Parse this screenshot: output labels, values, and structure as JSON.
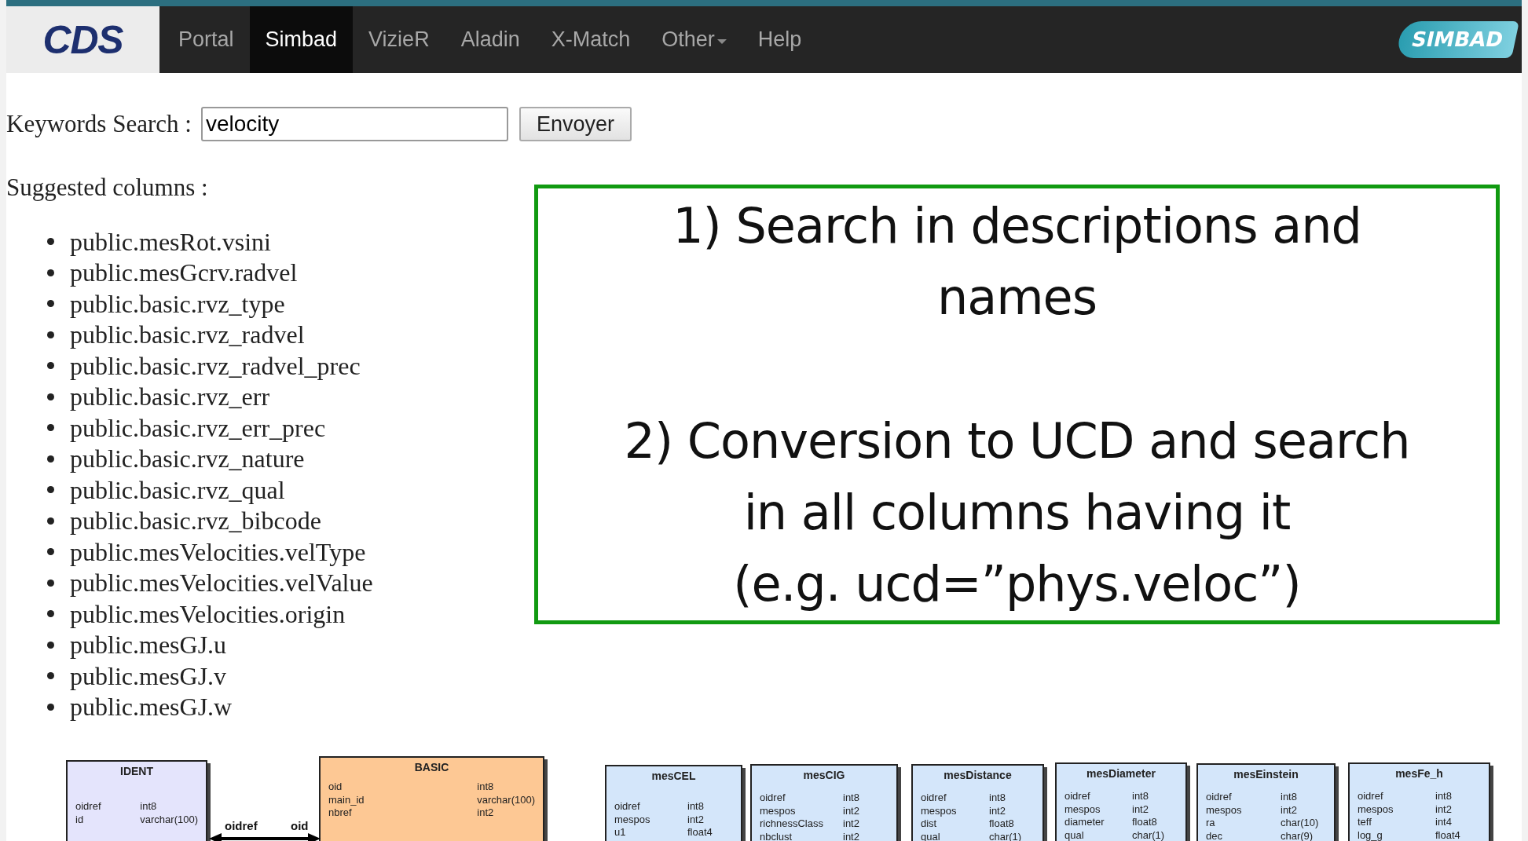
{
  "navbar": {
    "logo_text": "CDS",
    "items": [
      {
        "label": "Portal",
        "selected": false,
        "has_menu": false
      },
      {
        "label": "Simbad",
        "selected": true,
        "has_menu": false
      },
      {
        "label": "VizieR",
        "selected": false,
        "has_menu": false
      },
      {
        "label": "Aladin",
        "selected": false,
        "has_menu": false
      },
      {
        "label": "X-Match",
        "selected": false,
        "has_menu": false
      },
      {
        "label": "Other",
        "selected": false,
        "has_menu": true
      },
      {
        "label": "Help",
        "selected": false,
        "has_menu": false
      }
    ],
    "brand_text": "SIMBAD"
  },
  "search": {
    "label": "Keywords Search :",
    "value": "velocity",
    "button": "Envoyer"
  },
  "suggested": {
    "heading": "Suggested columns :",
    "items": [
      "public.mesRot.vsini",
      "public.mesGcrv.radvel",
      "public.basic.rvz_type",
      "public.basic.rvz_radvel",
      "public.basic.rvz_radvel_prec",
      "public.basic.rvz_err",
      "public.basic.rvz_err_prec",
      "public.basic.rvz_nature",
      "public.basic.rvz_qual",
      "public.basic.rvz_bibcode",
      "public.mesVelocities.velType",
      "public.mesVelocities.velValue",
      "public.mesVelocities.origin",
      "public.mesGJ.u",
      "public.mesGJ.v",
      "public.mesGJ.w"
    ]
  },
  "callout": {
    "paragraphs": [
      [
        "1) Search in descriptions and",
        "names"
      ],
      [
        "2) Conversion to UCD and search",
        "in all columns having it",
        "(e.g. ucd=”phys.veloc”)"
      ]
    ]
  },
  "diagram": {
    "relation": {
      "from_label": "oidref",
      "to_label": "oid"
    },
    "tables": [
      {
        "title": "IDENT",
        "color": "#e4e4fc",
        "columns": [
          {
            "name": "oidref",
            "type": "int8"
          },
          {
            "name": "id",
            "type": "varchar(100)"
          }
        ]
      },
      {
        "title": "BASIC",
        "color": "#fdc894",
        "columns": [
          {
            "name": "oid",
            "type": "int8"
          },
          {
            "name": "main_id",
            "type": "varchar(100)"
          },
          {
            "name": "nbref",
            "type": "int2"
          }
        ]
      },
      {
        "title": "mesCEL",
        "color": "#d4e6fa",
        "columns": [
          {
            "name": "oidref",
            "type": "int8"
          },
          {
            "name": "mespos",
            "type": "int2"
          },
          {
            "name": "u1",
            "type": "float4"
          }
        ]
      },
      {
        "title": "mesCIG",
        "color": "#d4e6fa",
        "columns": [
          {
            "name": "oidref",
            "type": "int8"
          },
          {
            "name": "mespos",
            "type": "int2"
          },
          {
            "name": "richnessClass",
            "type": "int2"
          },
          {
            "name": "nbclust",
            "type": "int2"
          }
        ]
      },
      {
        "title": "mesDistance",
        "color": "#d4e6fa",
        "columns": [
          {
            "name": "oidref",
            "type": "int8"
          },
          {
            "name": "mespos",
            "type": "int2"
          },
          {
            "name": "dist",
            "type": "float8"
          },
          {
            "name": "qual",
            "type": "char(1)"
          }
        ]
      },
      {
        "title": "mesDiameter",
        "color": "#d4e6fa",
        "columns": [
          {
            "name": "oidref",
            "type": "int8"
          },
          {
            "name": "mespos",
            "type": "int2"
          },
          {
            "name": "diameter",
            "type": "float8"
          },
          {
            "name": "qual",
            "type": "char(1)"
          }
        ]
      },
      {
        "title": "mesEinstein",
        "color": "#d4e6fa",
        "columns": [
          {
            "name": "oidref",
            "type": "int8"
          },
          {
            "name": "mespos",
            "type": "int2"
          },
          {
            "name": "ra",
            "type": "char(10)"
          },
          {
            "name": "dec",
            "type": "char(9)"
          }
        ]
      },
      {
        "title": "mesFe_h",
        "color": "#d4e6fa",
        "columns": [
          {
            "name": "oidref",
            "type": "int8"
          },
          {
            "name": "mespos",
            "type": "int2"
          },
          {
            "name": "teff",
            "type": "int4"
          },
          {
            "name": "log_g",
            "type": "float4"
          }
        ]
      }
    ]
  }
}
